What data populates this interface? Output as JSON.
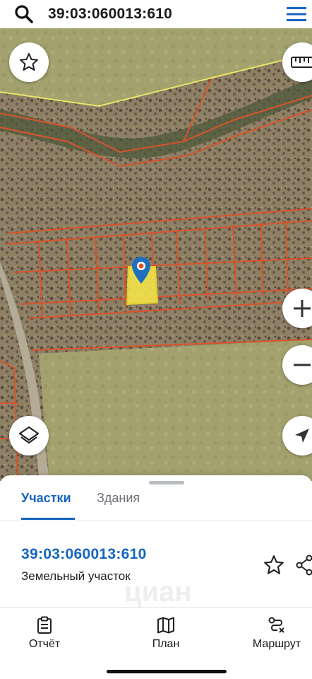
{
  "search": {
    "query": "39:03:060013:610",
    "icon": "search-icon"
  },
  "menu": {
    "icon": "hamburger-menu-icon"
  },
  "map": {
    "buttons": {
      "favorite": "star-icon",
      "ruler": "ruler-icon",
      "zoom_in": "plus-icon",
      "zoom_out": "minus-icon",
      "layers": "layers-icon",
      "locate": "navigation-arrow-icon"
    },
    "colors": {
      "parcel_border": "#d9532c",
      "selected_parcel": "#f3e34b",
      "pin": "#1e6fbe"
    }
  },
  "sheet": {
    "tabs": [
      {
        "label": "Участки",
        "active": true
      },
      {
        "label": "Здания",
        "active": false
      }
    ],
    "parcel": {
      "number": "39:03:060013:610",
      "type": "Земельный участок"
    },
    "watermark": "циан"
  },
  "bottom_nav": [
    {
      "label": "Отчёт",
      "icon": "report-clipboard-icon"
    },
    {
      "label": "План",
      "icon": "map-plan-icon"
    },
    {
      "label": "Маршрут",
      "icon": "route-icon"
    }
  ],
  "accent_color": "#1565c0"
}
